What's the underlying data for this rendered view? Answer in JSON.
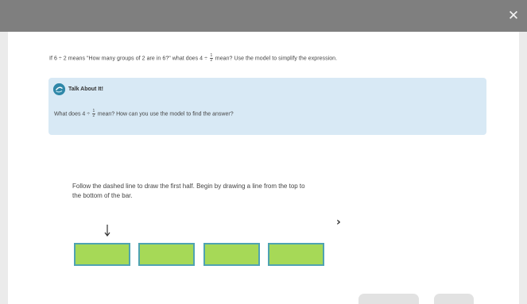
{
  "window": {
    "close_glyph": "✕"
  },
  "question": {
    "part1": "If 6 ÷ 2 means \"How many groups of 2 are in 6?\" what does 4 ÷ ",
    "frac_num": "1",
    "frac_den": "2",
    "part2": " mean? Use the model to simplify the expression."
  },
  "talk": {
    "title": "Talk About It!",
    "text_part1": "What does 4 ÷ ",
    "frac_num": "1",
    "frac_den": "2",
    "text_part2": " mean? How can you use the model to find the answer?"
  },
  "instruction": {
    "text": "Follow the dashed line to draw the first half. Begin by drawing a line from the top to the bottom of the bar."
  },
  "navigation": {
    "next_glyph": "›"
  },
  "colors": {
    "topbar": "#7f7f7f",
    "talk_background": "#d8e9f5",
    "bar_fill": "#a6d957",
    "bar_border": "#4fa3b2",
    "icon": "#2f87a8"
  },
  "icons": {
    "close": "close-icon",
    "talk": "talk-about-it-icon",
    "next": "chevron-right-icon",
    "pointer": "down-arrow-icon"
  },
  "model": {
    "bar_count": 4
  }
}
